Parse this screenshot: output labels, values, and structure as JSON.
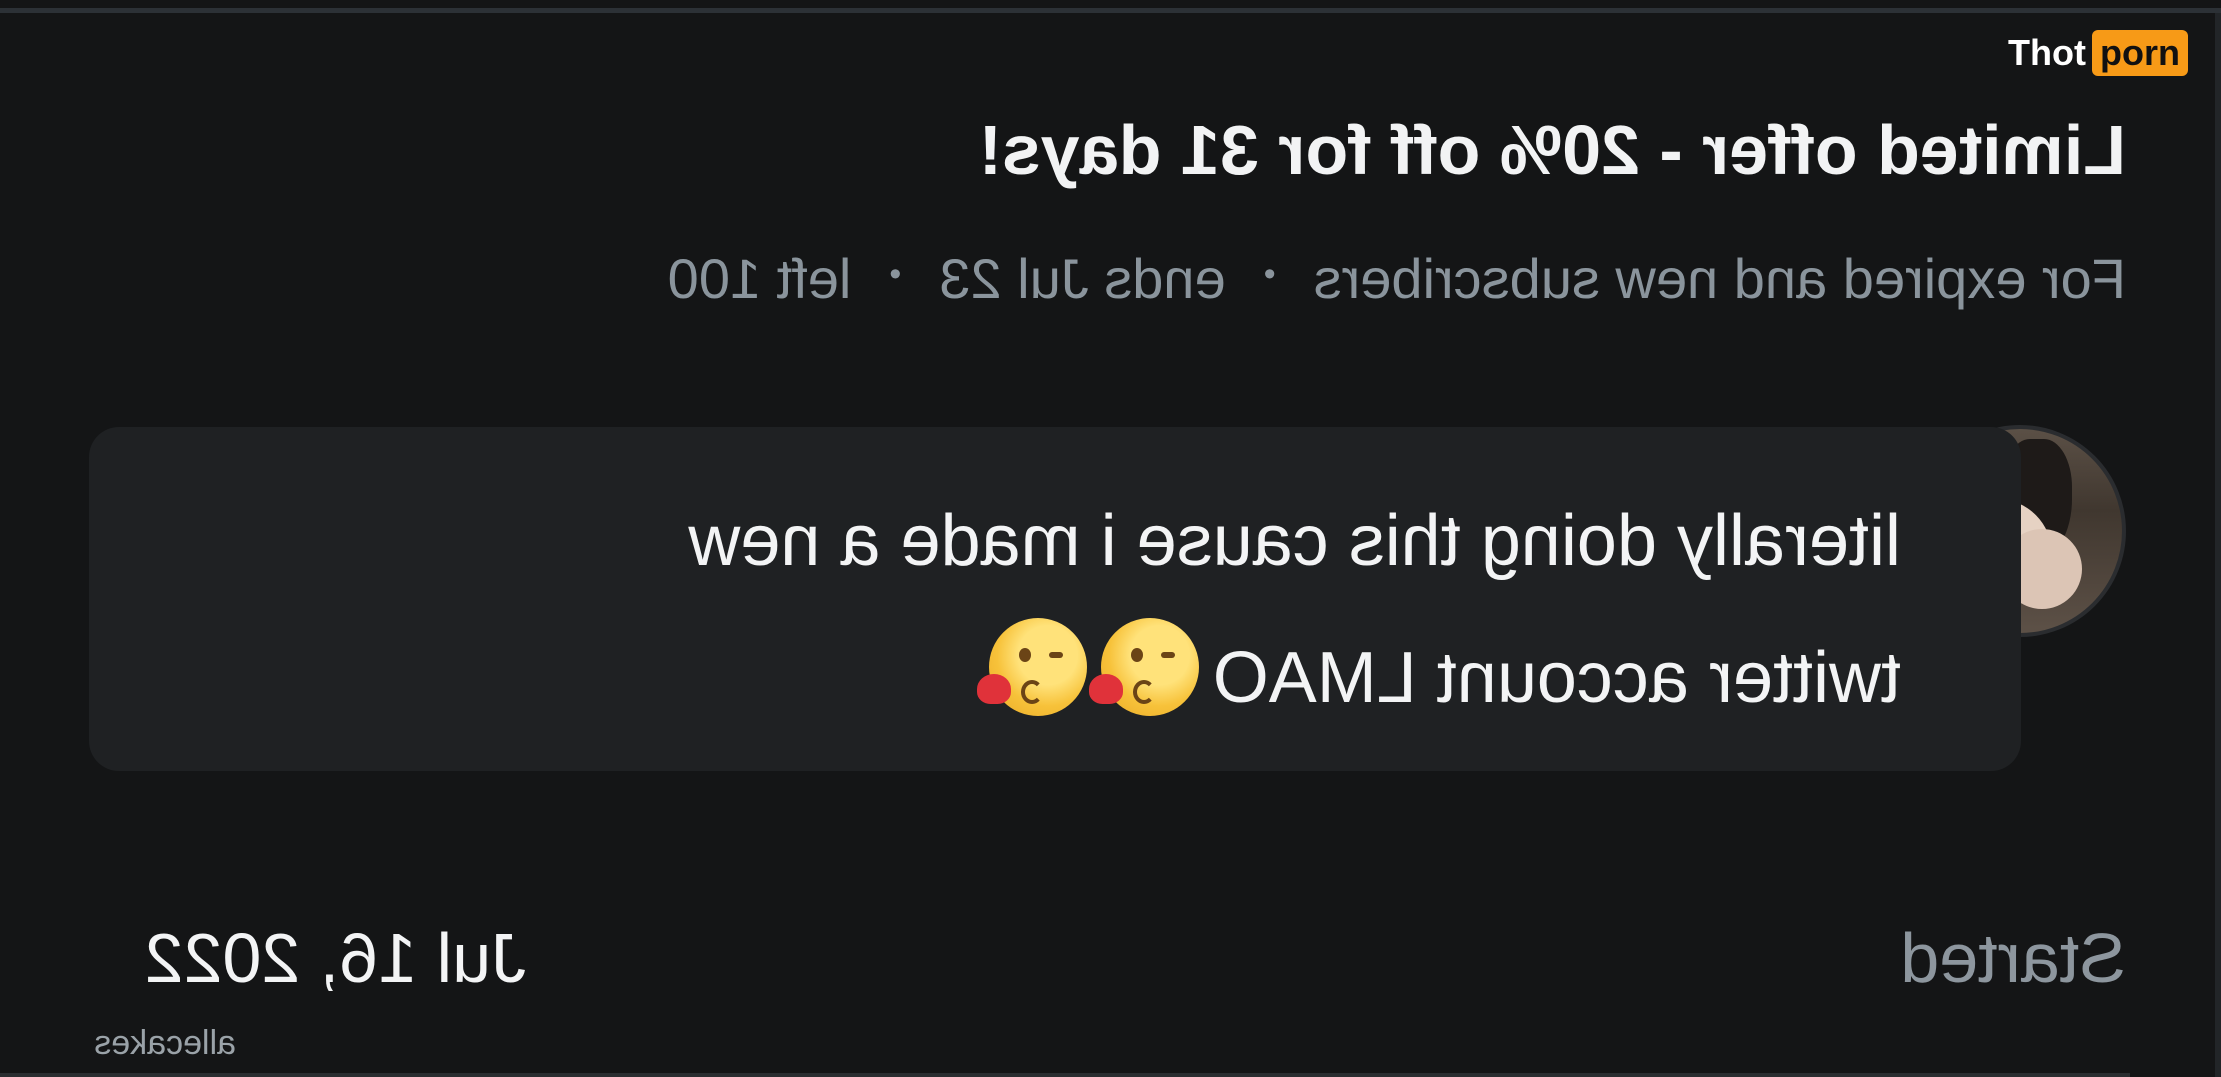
{
  "brand": {
    "part1": "Thot",
    "part2": "porn"
  },
  "offer": {
    "title": "Limited offer - 20% off for 31 days!",
    "audience": "For expired and new subscribers",
    "ends": "ends Jul 23",
    "left": "left 100",
    "separator": "•"
  },
  "message": {
    "line1": "literally doing this cause i made a new",
    "line2": "twitter account LMAO",
    "emoji_names": [
      "kissing-heart-emoji",
      "kissing-heart-emoji"
    ]
  },
  "meta": {
    "started_label": "Started",
    "started_date": "Jul 16, 2022"
  },
  "watermark_user": "allecakes",
  "colors": {
    "background": "#141516",
    "bubble": "#1f2123",
    "muted": "#8a949c",
    "brand_accent": "#f79a17"
  }
}
